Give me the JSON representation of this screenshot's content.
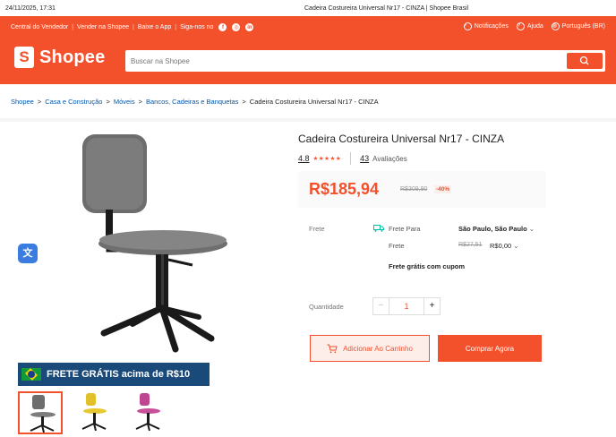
{
  "print": {
    "date": "24/11/2025, 17:31",
    "title": "Cadeira Costureira Universal Nr17 - CINZA | Shopee Brasil"
  },
  "topbar": {
    "links": [
      "Central do Vendedor",
      "Vender na Shopee",
      "Baixe o App",
      "Siga-nos no"
    ],
    "social_icons": [
      "facebook-icon",
      "instagram-icon",
      "linkedin-icon"
    ],
    "notifications": "Notificações",
    "help": "Ajuda",
    "language": "Português (BR)"
  },
  "header": {
    "brand": "Shopee",
    "search_placeholder": "Buscar na Shopee",
    "brand_color": "#f3502c"
  },
  "breadcrumb": {
    "items": [
      "Shopee",
      "Casa e Construção",
      "Móveis",
      "Bancos, Cadeiras e Banquetas"
    ],
    "separator": ">",
    "current": "Cadeira Costureira Universal Nr17 - CINZA"
  },
  "promo": {
    "text": "FRETE GRÁTIS acima de R$10"
  },
  "thumbnails": [
    {
      "color": "gray",
      "active": true
    },
    {
      "color": "yellow",
      "active": false
    },
    {
      "color": "pink",
      "active": false
    }
  ],
  "product": {
    "title": "Cadeira Costureira Universal Nr17 - CINZA",
    "rating": "4.8",
    "stars": "★★★★★",
    "reviews_count": "43",
    "reviews_label": "Avaliações",
    "price": "R$185,94",
    "old_price": "R$309,90",
    "discount": "-40%"
  },
  "shipping": {
    "label": "Frete",
    "frete_para": "Frete Para",
    "destination": "São Paulo, São Paulo",
    "frete": "Frete",
    "old_cost": "R$27,51",
    "new_cost": "R$0,00",
    "free_coupon": "Frete grátis com cupom"
  },
  "quantity": {
    "label": "Quantidade",
    "value": "1",
    "minus": "−",
    "plus": "+"
  },
  "actions": {
    "add_to_cart": "Adicionar Ao Carrinho",
    "buy_now": "Comprar Agora"
  }
}
